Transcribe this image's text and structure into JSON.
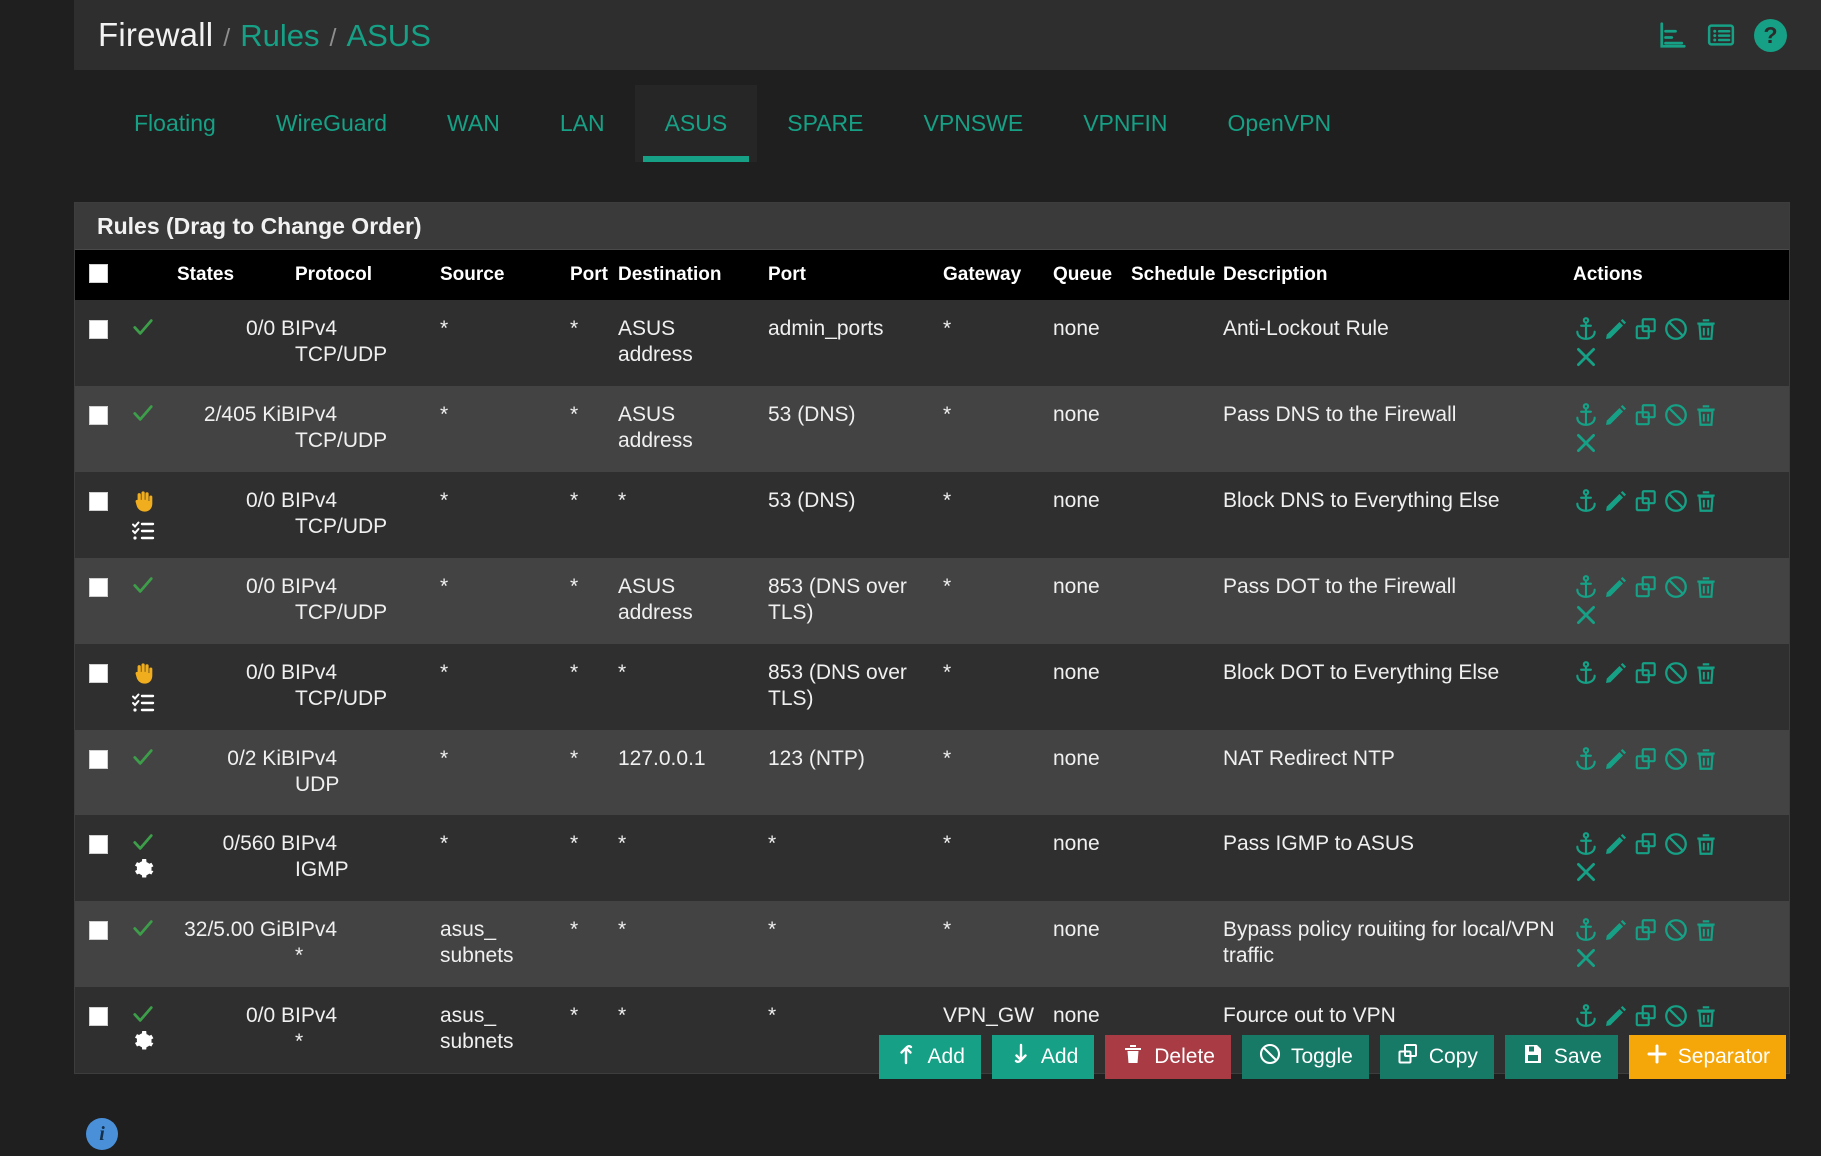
{
  "breadcrumb": {
    "root": "Firewall",
    "sep": "/",
    "section": "Rules",
    "current": "ASUS"
  },
  "header_icons": [
    {
      "name": "stats-icon",
      "label": "Statistics"
    },
    {
      "name": "list-icon",
      "label": "List"
    },
    {
      "name": "help-icon",
      "label": "?"
    }
  ],
  "tabs": [
    {
      "label": "Floating",
      "active": false
    },
    {
      "label": "WireGuard",
      "active": false
    },
    {
      "label": "WAN",
      "active": false
    },
    {
      "label": "LAN",
      "active": false
    },
    {
      "label": "ASUS",
      "active": true
    },
    {
      "label": "SPARE",
      "active": false
    },
    {
      "label": "VPNSWE",
      "active": false
    },
    {
      "label": "VPNFIN",
      "active": false
    },
    {
      "label": "OpenVPN",
      "active": false
    }
  ],
  "panel": {
    "title": "Rules (Drag to Change Order)"
  },
  "table": {
    "columns": [
      "",
      "",
      "States",
      "Protocol",
      "Source",
      "Port",
      "Destination",
      "Port",
      "Gateway",
      "Queue",
      "Schedule",
      "Description",
      "Actions"
    ],
    "headers": {
      "states": "States",
      "protocol": "Protocol",
      "source": "Source",
      "port_src": "Port",
      "destination": "Destination",
      "port_dst": "Port",
      "gateway": "Gateway",
      "queue": "Queue",
      "schedule": "Schedule",
      "description": "Description",
      "actions": "Actions"
    },
    "rows": [
      {
        "action_icon": "pass-check",
        "extra_icon": "",
        "states": "0/0 B",
        "protocol": "IPv4 TCP/UDP",
        "source": "*",
        "source_link": false,
        "port_src": "*",
        "destination": "ASUS address",
        "port_dst": "admin_ports",
        "port_dst_link": true,
        "gateway": "*",
        "gateway_link": false,
        "queue": "none",
        "schedule": "",
        "description": "Anti-Lockout Rule",
        "actions": [
          "anchor-icon",
          "edit-icon",
          "copy-icon",
          "block-icon",
          "trash-icon",
          "close-icon"
        ]
      },
      {
        "action_icon": "pass-check",
        "extra_icon": "",
        "states": "2/405 KiB",
        "protocol": "IPv4 TCP/UDP",
        "source": "*",
        "source_link": false,
        "port_src": "*",
        "destination": "ASUS address",
        "port_dst": "53 (DNS)",
        "port_dst_link": false,
        "gateway": "*",
        "gateway_link": false,
        "queue": "none",
        "schedule": "",
        "description": "Pass DNS to the Firewall",
        "actions": [
          "anchor-icon",
          "edit-icon",
          "copy-icon",
          "block-icon",
          "trash-icon",
          "close-icon"
        ]
      },
      {
        "action_icon": "block-hand",
        "extra_icon": "log-icon",
        "states": "0/0 B",
        "protocol": "IPv4 TCP/UDP",
        "source": "*",
        "source_link": false,
        "port_src": "*",
        "destination": "*",
        "port_dst": "53 (DNS)",
        "port_dst_link": false,
        "gateway": "*",
        "gateway_link": false,
        "queue": "none",
        "schedule": "",
        "description": "Block DNS to Everything Else",
        "actions": [
          "anchor-icon",
          "edit-icon",
          "copy-icon",
          "block-icon",
          "trash-icon"
        ]
      },
      {
        "action_icon": "pass-check",
        "extra_icon": "",
        "states": "0/0 B",
        "protocol": "IPv4 TCP/UDP",
        "source": "*",
        "source_link": false,
        "port_src": "*",
        "destination": "ASUS address",
        "port_dst": "853 (DNS over TLS)",
        "port_dst_link": false,
        "gateway": "*",
        "gateway_link": false,
        "queue": "none",
        "schedule": "",
        "description": "Pass DOT to the Firewall",
        "actions": [
          "anchor-icon",
          "edit-icon",
          "copy-icon",
          "block-icon",
          "trash-icon",
          "close-icon"
        ]
      },
      {
        "action_icon": "block-hand",
        "extra_icon": "log-icon",
        "states": "0/0 B",
        "protocol": "IPv4 TCP/UDP",
        "source": "*",
        "source_link": false,
        "port_src": "*",
        "destination": "*",
        "port_dst": "853 (DNS over TLS)",
        "port_dst_link": false,
        "gateway": "*",
        "gateway_link": false,
        "queue": "none",
        "schedule": "",
        "description": "Block DOT to Everything Else",
        "actions": [
          "anchor-icon",
          "edit-icon",
          "copy-icon",
          "block-icon",
          "trash-icon"
        ]
      },
      {
        "action_icon": "pass-check",
        "extra_icon": "",
        "states": "0/2 KiB",
        "protocol": "IPv4 UDP",
        "source": "*",
        "source_link": false,
        "port_src": "*",
        "destination": "127.0.0.1",
        "port_dst": "123 (NTP)",
        "port_dst_link": false,
        "gateway": "*",
        "gateway_link": false,
        "queue": "none",
        "schedule": "",
        "description": "NAT Redirect NTP",
        "actions": [
          "anchor-icon",
          "edit-icon",
          "copy-icon",
          "block-icon",
          "trash-icon"
        ]
      },
      {
        "action_icon": "pass-check",
        "extra_icon": "gear-icon",
        "states": "0/560 B",
        "protocol": "IPv4 IGMP",
        "source": "*",
        "source_link": false,
        "port_src": "*",
        "destination": "*",
        "port_dst": "*",
        "port_dst_link": false,
        "gateway": "*",
        "gateway_link": false,
        "queue": "none",
        "schedule": "",
        "description": "Pass IGMP to ASUS",
        "actions": [
          "anchor-icon",
          "edit-icon",
          "copy-icon",
          "block-icon",
          "trash-icon",
          "close-icon"
        ]
      },
      {
        "action_icon": "pass-check",
        "extra_icon": "",
        "states": "32/5.00 GiB",
        "protocol": "IPv4 *",
        "source": "asus_ subnets",
        "source_link": true,
        "port_src": "*",
        "destination": "*",
        "port_dst": "*",
        "port_dst_link": false,
        "gateway": "*",
        "gateway_link": false,
        "queue": "none",
        "schedule": "",
        "description": "Bypass policy rouiting for local/VPN traffic",
        "actions": [
          "anchor-icon",
          "edit-icon",
          "copy-icon",
          "block-icon",
          "trash-icon",
          "close-icon"
        ]
      },
      {
        "action_icon": "pass-check",
        "extra_icon": "gear-icon",
        "states": "0/0 B",
        "protocol": "IPv4 *",
        "source": "asus_ subnets",
        "source_link": true,
        "port_src": "*",
        "destination": "*",
        "port_dst": "*",
        "port_dst_link": false,
        "gateway": "VPN_GW",
        "gateway_link": true,
        "queue": "none",
        "schedule": "",
        "description": "Fource out to VPN",
        "actions": [
          "anchor-icon",
          "edit-icon",
          "copy-icon",
          "block-icon",
          "trash-icon",
          "close-icon"
        ]
      }
    ]
  },
  "buttons": [
    {
      "label": "Add",
      "icon": "arrow-up-icon",
      "style": "teal",
      "name": "add-up-button"
    },
    {
      "label": "Add",
      "icon": "arrow-down-icon",
      "style": "teal",
      "name": "add-down-button"
    },
    {
      "label": "Delete",
      "icon": "trash-icon",
      "style": "red",
      "name": "delete-button"
    },
    {
      "label": "Toggle",
      "icon": "block-icon",
      "style": "dteal",
      "name": "toggle-button"
    },
    {
      "label": "Copy",
      "icon": "copy-icon",
      "style": "dteal",
      "name": "copy-button"
    },
    {
      "label": "Save",
      "icon": "save-icon",
      "style": "dteal",
      "name": "save-button"
    },
    {
      "label": "Separator",
      "icon": "plus-icon",
      "style": "orange",
      "name": "separator-button"
    }
  ],
  "footer": {
    "info_label": "i"
  },
  "colors": {
    "accent_teal": "#16a085",
    "pass_green": "#3d9e4a",
    "block_orange": "#f0ad1e",
    "danger_red": "#a93b44",
    "separator_orange": "#f5a609",
    "info_blue": "#4a90d9",
    "bg": "#1f1f1f",
    "row_dark": "#2f2f2f",
    "row_light": "#434343",
    "header_black": "#000000"
  }
}
